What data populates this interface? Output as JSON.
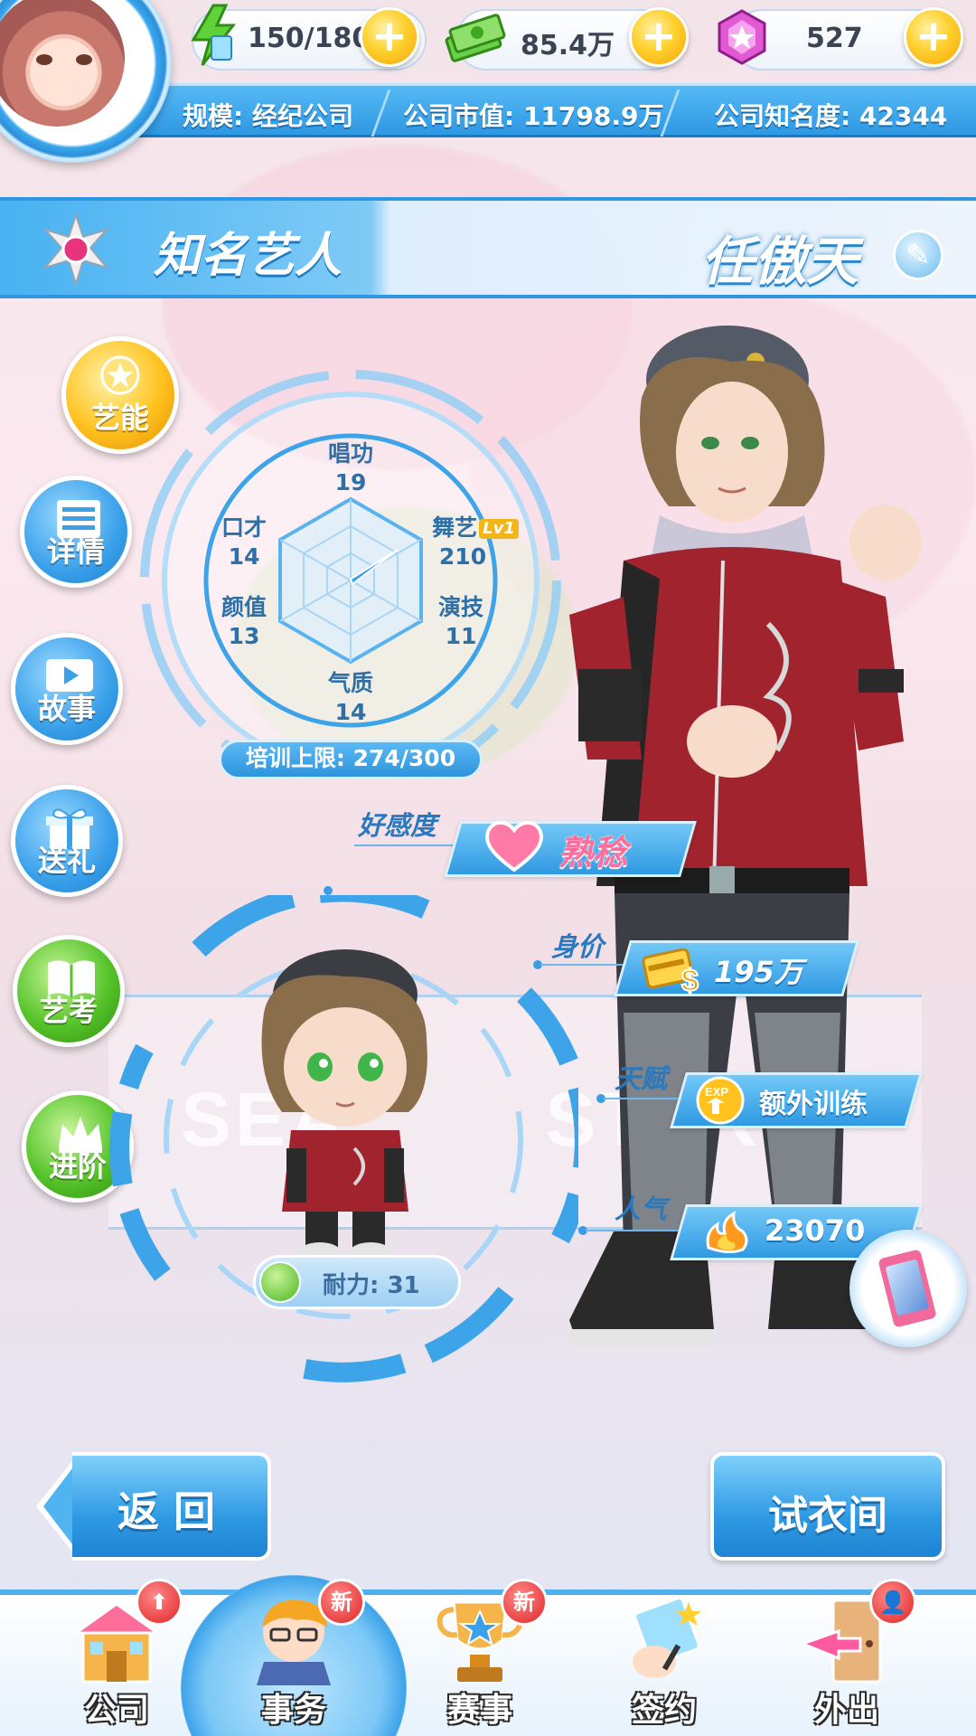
{
  "resources": {
    "stamina": "150/180",
    "money": "85.4万",
    "gems": "527"
  },
  "company": {
    "scale": "规模: 经纪公司",
    "market_value": "公司市值: 11798.9万",
    "fame": "公司知名度: 42344"
  },
  "header": {
    "title": "知名艺人",
    "artist_name": "任傲天"
  },
  "side_menu": [
    {
      "label": "艺能"
    },
    {
      "label": "详情"
    },
    {
      "label": "故事"
    },
    {
      "label": "送礼"
    },
    {
      "label": "艺考"
    },
    {
      "label": "进阶"
    }
  ],
  "stats": {
    "singing": {
      "label": "唱功",
      "value": "19"
    },
    "dance": {
      "label": "舞艺",
      "value": "210",
      "level": "Lv1"
    },
    "acting": {
      "label": "演技",
      "value": "11"
    },
    "temperament": {
      "label": "气质",
      "value": "14"
    },
    "looks": {
      "label": "颜值",
      "value": "13"
    },
    "eloquence": {
      "label": "口才",
      "value": "14"
    },
    "train_limit": "培训上限: 274/300"
  },
  "attributes": {
    "affinity": {
      "label": "好感度",
      "value": "熟稔"
    },
    "price": {
      "label": "身价",
      "value": "195万"
    },
    "talent": {
      "label": "天赋",
      "value": "额外训练"
    },
    "popularity": {
      "label": "人气",
      "value": "23070"
    }
  },
  "stamina_pill": "耐力: 31",
  "buttons": {
    "back": "返回",
    "wardrobe": "试衣间"
  },
  "bottom_nav": [
    {
      "label": "公司",
      "badge": ""
    },
    {
      "label": "事务",
      "badge": "新"
    },
    {
      "label": "赛事",
      "badge": "新"
    },
    {
      "label": "签约",
      "badge": ""
    },
    {
      "label": "外出",
      "badge": ""
    }
  ],
  "colors": {
    "accent_blue": "#2f98e1",
    "gold": "#ffc21e",
    "green": "#56c42a",
    "pink": "#ff6e9a"
  }
}
